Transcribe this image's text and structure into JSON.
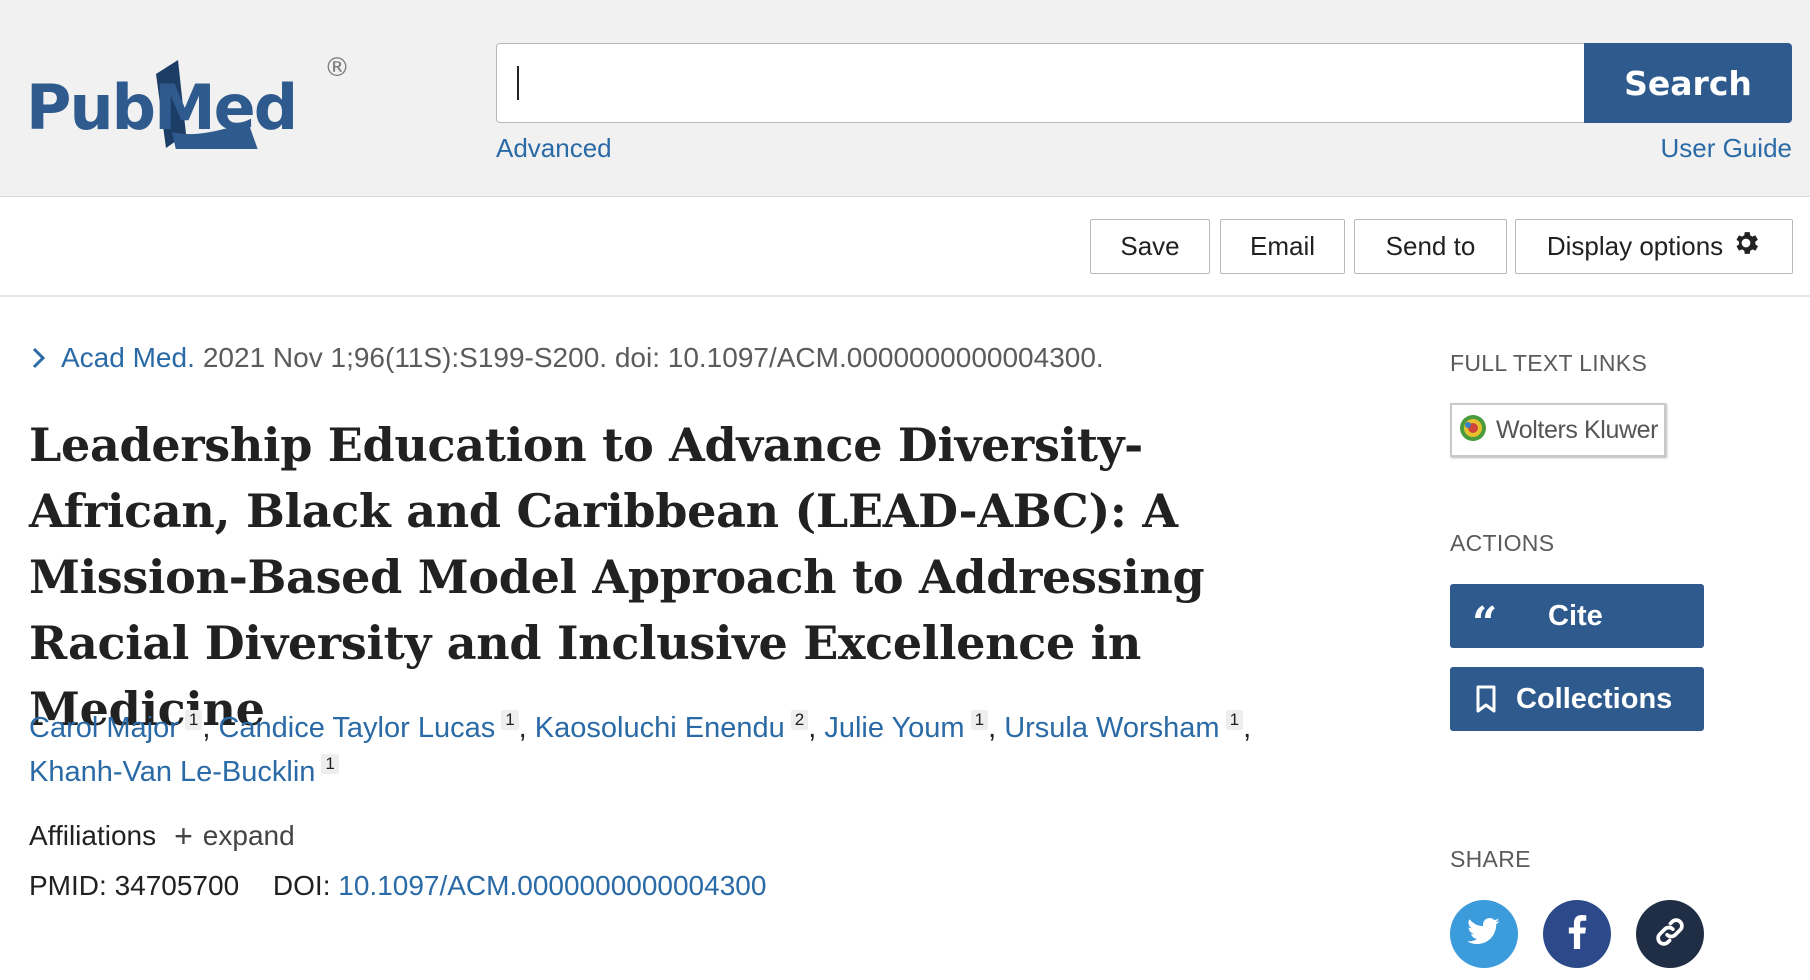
{
  "header": {
    "logo_text": "PubMed",
    "logo_mark": "®",
    "search": {
      "value": "",
      "placeholder": ""
    },
    "search_label": "Search",
    "advanced_label": "Advanced",
    "user_guide_label": "User Guide"
  },
  "toolbar": {
    "save_label": "Save",
    "email_label": "Email",
    "send_to_label": "Send to",
    "display_options_label": "Display options"
  },
  "article": {
    "journal": "Acad Med.",
    "citation_rest": "2021 Nov 1;96(11S):S199-S200. doi: 10.1097/ACM.0000000000004300.",
    "title": "Leadership Education to Advance Diversity-African, Black and Caribbean (LEAD-ABC): A Mission-Based Model Approach to Addressing Racial Diversity and Inclusive Excellence in Medicine",
    "authors": [
      {
        "name": "Carol Major",
        "aff": "1",
        "sep": ", "
      },
      {
        "name": "Candice Taylor Lucas",
        "aff": "1",
        "sep": ", "
      },
      {
        "name": "Kaosoluchi Enendu",
        "aff": "2",
        "sep": ", "
      },
      {
        "name": "Julie Youm",
        "aff": "1",
        "sep": ", "
      },
      {
        "name": "Ursula Worsham",
        "aff": "1",
        "sep": ","
      },
      {
        "name": "Khanh-Van Le-Bucklin",
        "aff": "1",
        "sep": ""
      }
    ],
    "affiliations_label": "Affiliations",
    "expand_label": "expand",
    "pmid_label": "PMID:",
    "pmid": "34705700",
    "doi_label": "DOI:",
    "doi": "10.1097/ACM.0000000000004300"
  },
  "sidebar": {
    "full_text_heading": "FULL TEXT LINKS",
    "full_text_provider": "Wolters Kluwer",
    "actions_heading": "ACTIONS",
    "cite_label": "Cite",
    "collections_label": "Collections",
    "share_heading": "SHARE"
  },
  "colors": {
    "brand_blue": "#2e5a8e",
    "link_blue": "#2a6aa6",
    "twitter": "#3c9bdb",
    "facebook": "#2c4a8a",
    "permalink": "#1f2d45",
    "header_bg": "#f1f1f1"
  },
  "icons": {
    "logo": "pubmed-logo",
    "chevron": "chevron-right-icon",
    "gear": "gear-icon",
    "quote": "quote-icon",
    "bookmark": "bookmark-icon",
    "twitter": "twitter-icon",
    "facebook": "facebook-icon",
    "link": "link-icon",
    "plus": "plus-icon"
  }
}
